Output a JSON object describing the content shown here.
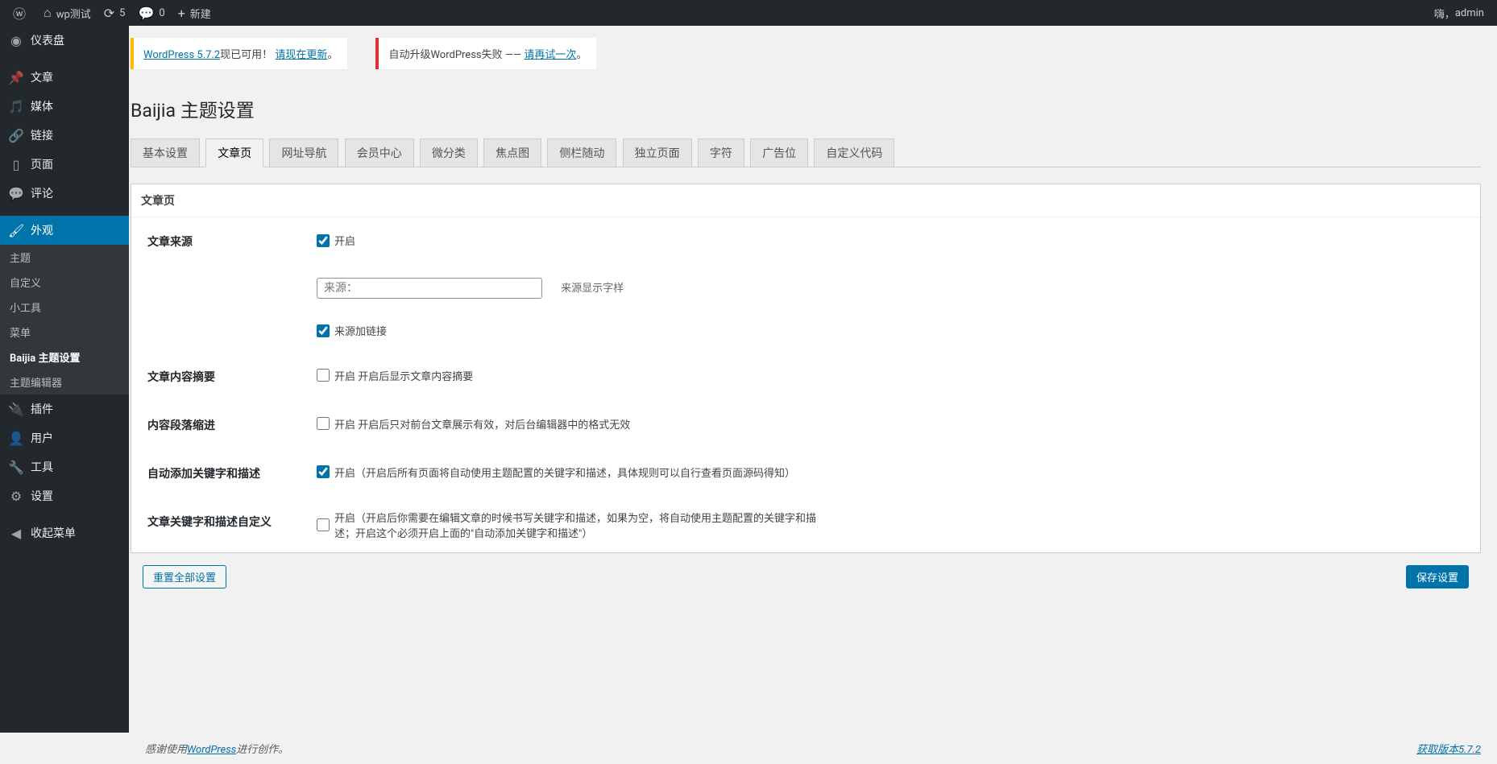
{
  "adminbar": {
    "site_name": "wp测试",
    "updates_count": "5",
    "comments_count": "0",
    "new_label": "新建",
    "greeting": "嗨，",
    "user": "admin"
  },
  "sidebar": {
    "items": [
      {
        "label": "仪表盘"
      },
      {
        "label": "文章"
      },
      {
        "label": "媒体"
      },
      {
        "label": "链接"
      },
      {
        "label": "页面"
      },
      {
        "label": "评论"
      },
      {
        "label": "外观"
      },
      {
        "label": "插件"
      },
      {
        "label": "用户"
      },
      {
        "label": "工具"
      },
      {
        "label": "设置"
      },
      {
        "label": "收起菜单"
      }
    ],
    "appearance_submenu": [
      {
        "label": "主题"
      },
      {
        "label": "自定义"
      },
      {
        "label": "小工具"
      },
      {
        "label": "菜单"
      },
      {
        "label": "Baijia 主题设置"
      },
      {
        "label": "主题编辑器"
      }
    ]
  },
  "notices": {
    "update_version": "WordPress 5.7.2",
    "update_suffix": "现已可用！",
    "update_link": "请现在更新",
    "upgrade_fail_prefix": "自动升级WordPress失败 —— ",
    "upgrade_fail_link": "请再试一次"
  },
  "page_title": "Baijia 主题设置",
  "tabs": [
    {
      "label": "基本设置"
    },
    {
      "label": "文章页"
    },
    {
      "label": "网址导航"
    },
    {
      "label": "会员中心"
    },
    {
      "label": "微分类"
    },
    {
      "label": "焦点图"
    },
    {
      "label": "侧栏随动"
    },
    {
      "label": "独立页面"
    },
    {
      "label": "字符"
    },
    {
      "label": "广告位"
    },
    {
      "label": "自定义代码"
    }
  ],
  "section_title": "文章页",
  "fields": {
    "source": {
      "label": "文章来源",
      "enable": "开启",
      "text_placeholder": "来源：",
      "text_desc": "来源显示字样",
      "link_enable": "来源加链接"
    },
    "excerpt": {
      "label": "文章内容摘要",
      "enable": "开启 开启后显示文章内容摘要"
    },
    "indent": {
      "label": "内容段落缩进",
      "enable": "开启 开启后只对前台文章展示有效，对后台编辑器中的格式无效"
    },
    "autokw": {
      "label": "自动添加关键字和描述",
      "enable": "开启（开启后所有页面将自动使用主题配置的关键字和描述，具体规则可以自行查看页面源码得知）"
    },
    "customkw": {
      "label": "文章关键字和描述自定义",
      "enable": "开启（开启后你需要在编辑文章的时候书写关键字和描述，如果为空，将自动使用主题配置的关键字和描述；开启这个必须开启上面的\"自动添加关键字和描述\"）"
    }
  },
  "buttons": {
    "reset": "重置全部设置",
    "save": "保存设置"
  },
  "footer": {
    "thanks_prefix": "感谢使用",
    "thanks_link": "WordPress",
    "thanks_suffix": "进行创作。",
    "version": "获取版本5.7.2"
  }
}
